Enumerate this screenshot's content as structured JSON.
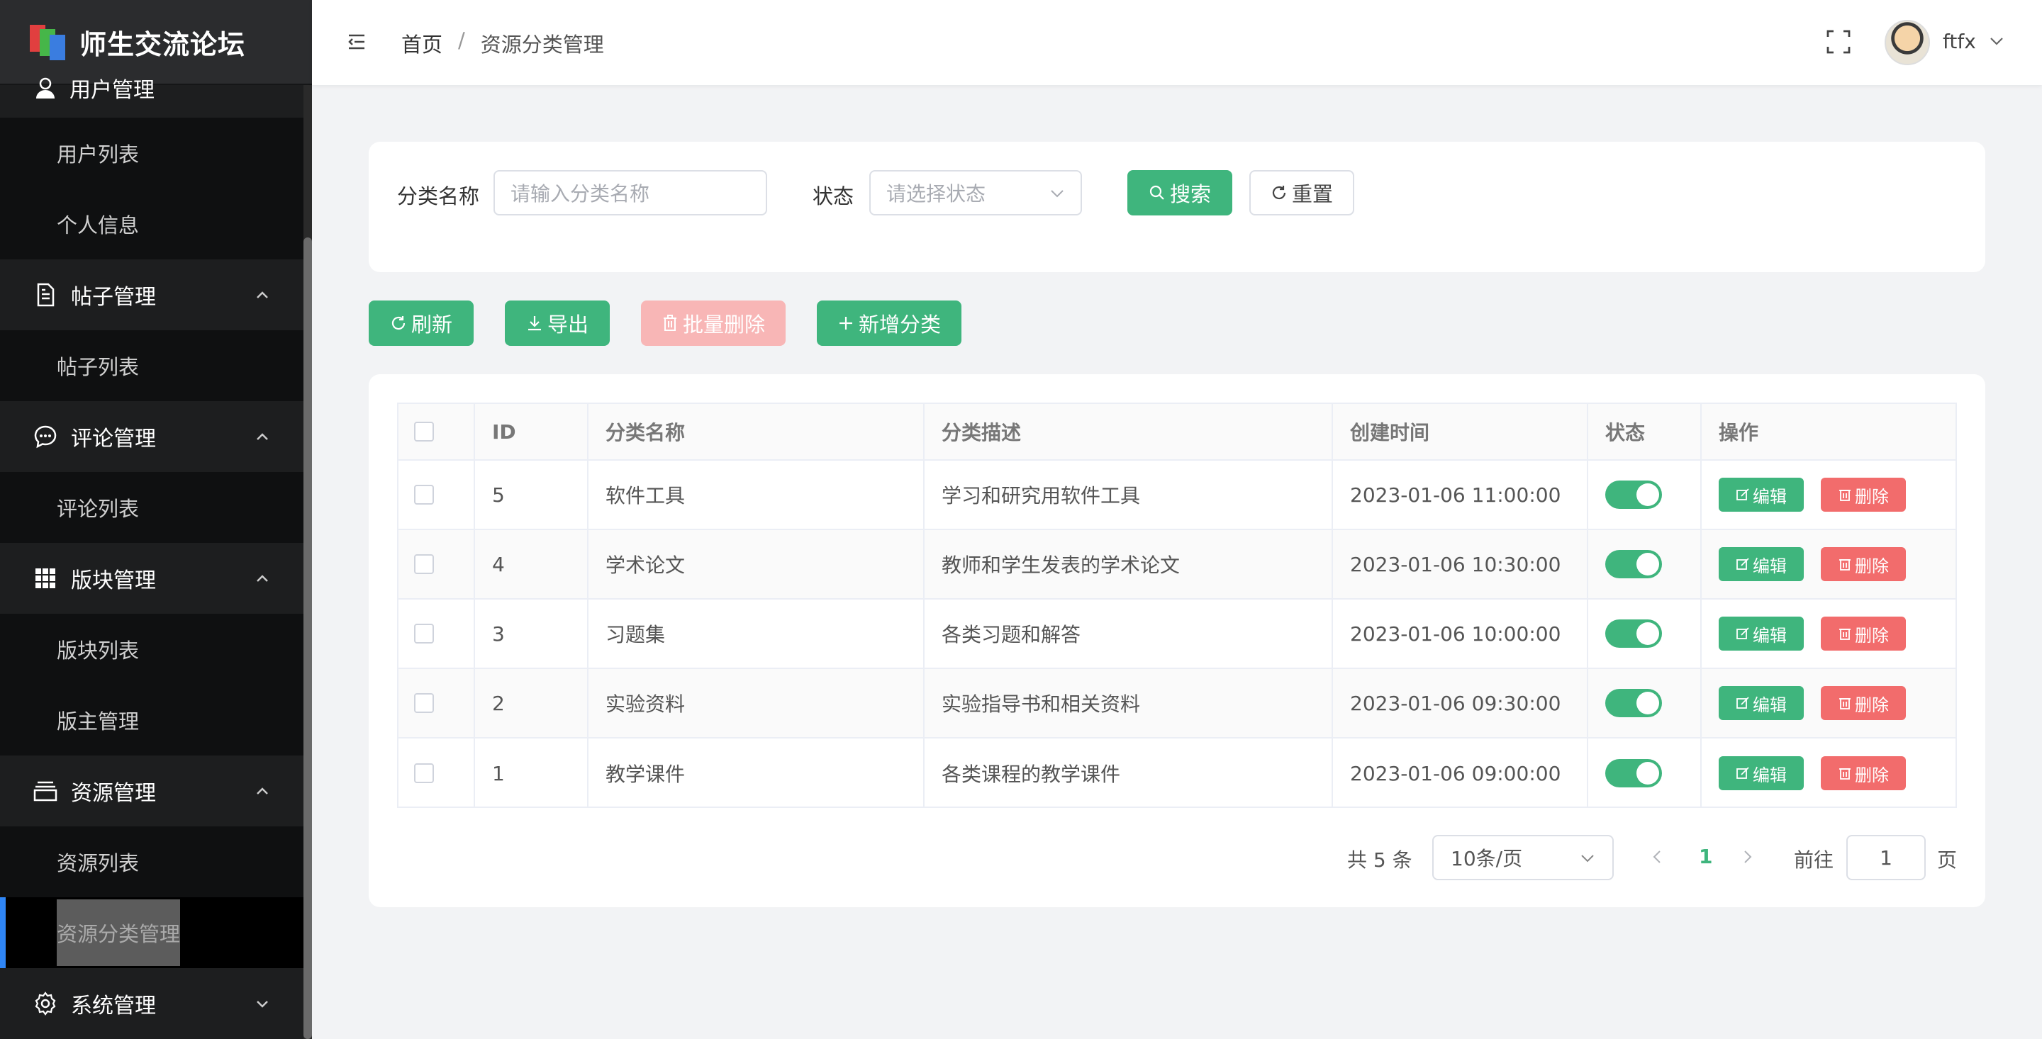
{
  "app": {
    "title": "师生交流论坛"
  },
  "sidebar": {
    "partial_group": "用户管理",
    "groups": [
      {
        "label": "帖子管理",
        "icon": "document-icon",
        "items": [
          "帖子列表"
        ]
      },
      {
        "label": "评论管理",
        "icon": "chat-bubble-icon",
        "items": [
          "评论列表"
        ]
      },
      {
        "label": "版块管理",
        "icon": "grid-icon",
        "items": [
          "版块列表",
          "版主管理"
        ]
      },
      {
        "label": "资源管理",
        "icon": "box-icon",
        "items": [
          "资源列表",
          "资源分类管理"
        ]
      },
      {
        "label": "系统管理",
        "icon": "gear-icon",
        "items": []
      }
    ],
    "user_items": [
      "用户列表",
      "个人信息"
    ],
    "active_item": "资源分类管理"
  },
  "header": {
    "breadcrumb": [
      "首页",
      "资源分类管理"
    ],
    "separator": "/",
    "username": "ftfx"
  },
  "search": {
    "name_label": "分类名称",
    "name_placeholder": "请输入分类名称",
    "status_label": "状态",
    "status_placeholder": "请选择状态",
    "search_button": "搜索",
    "reset_button": "重置"
  },
  "toolbar": {
    "refresh": "刷新",
    "export": "导出",
    "batch_delete": "批量删除",
    "add": "新增分类"
  },
  "table": {
    "columns": [
      "ID",
      "分类名称",
      "分类描述",
      "创建时间",
      "状态",
      "操作"
    ],
    "rows": [
      {
        "id": "5",
        "name": "软件工具",
        "desc": "学习和研究用软件工具",
        "time": "2023-01-06 11:00:00",
        "enabled": true
      },
      {
        "id": "4",
        "name": "学术论文",
        "desc": "教师和学生发表的学术论文",
        "time": "2023-01-06 10:30:00",
        "enabled": true
      },
      {
        "id": "3",
        "name": "习题集",
        "desc": "各类习题和解答",
        "time": "2023-01-06 10:00:00",
        "enabled": true
      },
      {
        "id": "2",
        "name": "实验资料",
        "desc": "实验指导书和相关资料",
        "time": "2023-01-06 09:30:00",
        "enabled": true
      },
      {
        "id": "1",
        "name": "教学课件",
        "desc": "各类课程的教学课件",
        "time": "2023-01-06 09:00:00",
        "enabled": true
      }
    ],
    "edit_label": "编辑",
    "delete_label": "删除"
  },
  "pagination": {
    "total": "共 5 条",
    "page_size": "10条/页",
    "current_page": "1",
    "goto_label": "前往",
    "goto_value": "1",
    "page_suffix": "页"
  },
  "colors": {
    "primary": "#3fb57d",
    "danger": "#f26c6c",
    "sidebar_bg": "#1d1e1f",
    "active_indicator": "#2f86f6"
  }
}
